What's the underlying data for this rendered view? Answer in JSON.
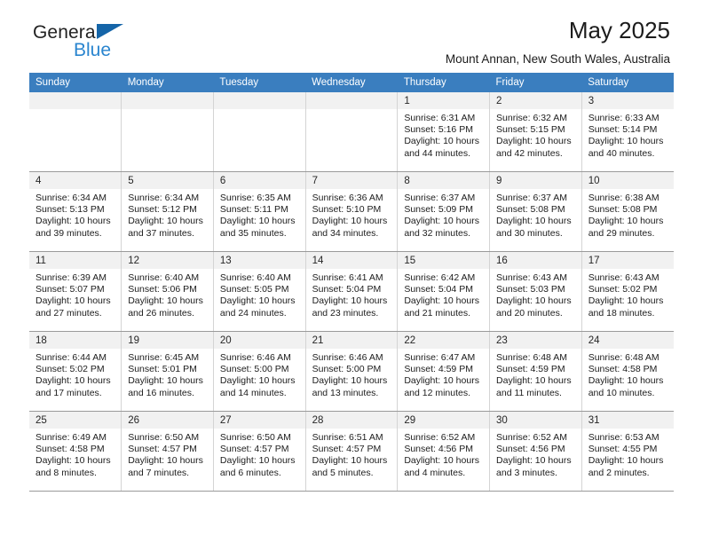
{
  "brand": {
    "name_line1": "General",
    "name_line2": "Blue",
    "blue": "#2a85cf",
    "triangle_color": "#1565a8"
  },
  "header": {
    "title": "May 2025",
    "subtitle": "Mount Annan, New South Wales, Australia",
    "header_bg": "#3a7ebf"
  },
  "weekday_headers": [
    "Sunday",
    "Monday",
    "Tuesday",
    "Wednesday",
    "Thursday",
    "Friday",
    "Saturday"
  ],
  "labels": {
    "sunrise_prefix": "Sunrise: ",
    "sunset_prefix": "Sunset: ",
    "daylight_prefix": "Daylight: "
  },
  "weeks": [
    [
      {
        "day": "",
        "sunrise": "",
        "sunset": "",
        "daylight_l1": "",
        "daylight_l2": ""
      },
      {
        "day": "",
        "sunrise": "",
        "sunset": "",
        "daylight_l1": "",
        "daylight_l2": ""
      },
      {
        "day": "",
        "sunrise": "",
        "sunset": "",
        "daylight_l1": "",
        "daylight_l2": ""
      },
      {
        "day": "",
        "sunrise": "",
        "sunset": "",
        "daylight_l1": "",
        "daylight_l2": ""
      },
      {
        "day": "1",
        "sunrise": "Sunrise: 6:31 AM",
        "sunset": "Sunset: 5:16 PM",
        "daylight_l1": "Daylight: 10 hours",
        "daylight_l2": "and 44 minutes."
      },
      {
        "day": "2",
        "sunrise": "Sunrise: 6:32 AM",
        "sunset": "Sunset: 5:15 PM",
        "daylight_l1": "Daylight: 10 hours",
        "daylight_l2": "and 42 minutes."
      },
      {
        "day": "3",
        "sunrise": "Sunrise: 6:33 AM",
        "sunset": "Sunset: 5:14 PM",
        "daylight_l1": "Daylight: 10 hours",
        "daylight_l2": "and 40 minutes."
      }
    ],
    [
      {
        "day": "4",
        "sunrise": "Sunrise: 6:34 AM",
        "sunset": "Sunset: 5:13 PM",
        "daylight_l1": "Daylight: 10 hours",
        "daylight_l2": "and 39 minutes."
      },
      {
        "day": "5",
        "sunrise": "Sunrise: 6:34 AM",
        "sunset": "Sunset: 5:12 PM",
        "daylight_l1": "Daylight: 10 hours",
        "daylight_l2": "and 37 minutes."
      },
      {
        "day": "6",
        "sunrise": "Sunrise: 6:35 AM",
        "sunset": "Sunset: 5:11 PM",
        "daylight_l1": "Daylight: 10 hours",
        "daylight_l2": "and 35 minutes."
      },
      {
        "day": "7",
        "sunrise": "Sunrise: 6:36 AM",
        "sunset": "Sunset: 5:10 PM",
        "daylight_l1": "Daylight: 10 hours",
        "daylight_l2": "and 34 minutes."
      },
      {
        "day": "8",
        "sunrise": "Sunrise: 6:37 AM",
        "sunset": "Sunset: 5:09 PM",
        "daylight_l1": "Daylight: 10 hours",
        "daylight_l2": "and 32 minutes."
      },
      {
        "day": "9",
        "sunrise": "Sunrise: 6:37 AM",
        "sunset": "Sunset: 5:08 PM",
        "daylight_l1": "Daylight: 10 hours",
        "daylight_l2": "and 30 minutes."
      },
      {
        "day": "10",
        "sunrise": "Sunrise: 6:38 AM",
        "sunset": "Sunset: 5:08 PM",
        "daylight_l1": "Daylight: 10 hours",
        "daylight_l2": "and 29 minutes."
      }
    ],
    [
      {
        "day": "11",
        "sunrise": "Sunrise: 6:39 AM",
        "sunset": "Sunset: 5:07 PM",
        "daylight_l1": "Daylight: 10 hours",
        "daylight_l2": "and 27 minutes."
      },
      {
        "day": "12",
        "sunrise": "Sunrise: 6:40 AM",
        "sunset": "Sunset: 5:06 PM",
        "daylight_l1": "Daylight: 10 hours",
        "daylight_l2": "and 26 minutes."
      },
      {
        "day": "13",
        "sunrise": "Sunrise: 6:40 AM",
        "sunset": "Sunset: 5:05 PM",
        "daylight_l1": "Daylight: 10 hours",
        "daylight_l2": "and 24 minutes."
      },
      {
        "day": "14",
        "sunrise": "Sunrise: 6:41 AM",
        "sunset": "Sunset: 5:04 PM",
        "daylight_l1": "Daylight: 10 hours",
        "daylight_l2": "and 23 minutes."
      },
      {
        "day": "15",
        "sunrise": "Sunrise: 6:42 AM",
        "sunset": "Sunset: 5:04 PM",
        "daylight_l1": "Daylight: 10 hours",
        "daylight_l2": "and 21 minutes."
      },
      {
        "day": "16",
        "sunrise": "Sunrise: 6:43 AM",
        "sunset": "Sunset: 5:03 PM",
        "daylight_l1": "Daylight: 10 hours",
        "daylight_l2": "and 20 minutes."
      },
      {
        "day": "17",
        "sunrise": "Sunrise: 6:43 AM",
        "sunset": "Sunset: 5:02 PM",
        "daylight_l1": "Daylight: 10 hours",
        "daylight_l2": "and 18 minutes."
      }
    ],
    [
      {
        "day": "18",
        "sunrise": "Sunrise: 6:44 AM",
        "sunset": "Sunset: 5:02 PM",
        "daylight_l1": "Daylight: 10 hours",
        "daylight_l2": "and 17 minutes."
      },
      {
        "day": "19",
        "sunrise": "Sunrise: 6:45 AM",
        "sunset": "Sunset: 5:01 PM",
        "daylight_l1": "Daylight: 10 hours",
        "daylight_l2": "and 16 minutes."
      },
      {
        "day": "20",
        "sunrise": "Sunrise: 6:46 AM",
        "sunset": "Sunset: 5:00 PM",
        "daylight_l1": "Daylight: 10 hours",
        "daylight_l2": "and 14 minutes."
      },
      {
        "day": "21",
        "sunrise": "Sunrise: 6:46 AM",
        "sunset": "Sunset: 5:00 PM",
        "daylight_l1": "Daylight: 10 hours",
        "daylight_l2": "and 13 minutes."
      },
      {
        "day": "22",
        "sunrise": "Sunrise: 6:47 AM",
        "sunset": "Sunset: 4:59 PM",
        "daylight_l1": "Daylight: 10 hours",
        "daylight_l2": "and 12 minutes."
      },
      {
        "day": "23",
        "sunrise": "Sunrise: 6:48 AM",
        "sunset": "Sunset: 4:59 PM",
        "daylight_l1": "Daylight: 10 hours",
        "daylight_l2": "and 11 minutes."
      },
      {
        "day": "24",
        "sunrise": "Sunrise: 6:48 AM",
        "sunset": "Sunset: 4:58 PM",
        "daylight_l1": "Daylight: 10 hours",
        "daylight_l2": "and 10 minutes."
      }
    ],
    [
      {
        "day": "25",
        "sunrise": "Sunrise: 6:49 AM",
        "sunset": "Sunset: 4:58 PM",
        "daylight_l1": "Daylight: 10 hours",
        "daylight_l2": "and 8 minutes."
      },
      {
        "day": "26",
        "sunrise": "Sunrise: 6:50 AM",
        "sunset": "Sunset: 4:57 PM",
        "daylight_l1": "Daylight: 10 hours",
        "daylight_l2": "and 7 minutes."
      },
      {
        "day": "27",
        "sunrise": "Sunrise: 6:50 AM",
        "sunset": "Sunset: 4:57 PM",
        "daylight_l1": "Daylight: 10 hours",
        "daylight_l2": "and 6 minutes."
      },
      {
        "day": "28",
        "sunrise": "Sunrise: 6:51 AM",
        "sunset": "Sunset: 4:57 PM",
        "daylight_l1": "Daylight: 10 hours",
        "daylight_l2": "and 5 minutes."
      },
      {
        "day": "29",
        "sunrise": "Sunrise: 6:52 AM",
        "sunset": "Sunset: 4:56 PM",
        "daylight_l1": "Daylight: 10 hours",
        "daylight_l2": "and 4 minutes."
      },
      {
        "day": "30",
        "sunrise": "Sunrise: 6:52 AM",
        "sunset": "Sunset: 4:56 PM",
        "daylight_l1": "Daylight: 10 hours",
        "daylight_l2": "and 3 minutes."
      },
      {
        "day": "31",
        "sunrise": "Sunrise: 6:53 AM",
        "sunset": "Sunset: 4:55 PM",
        "daylight_l1": "Daylight: 10 hours",
        "daylight_l2": "and 2 minutes."
      }
    ]
  ]
}
